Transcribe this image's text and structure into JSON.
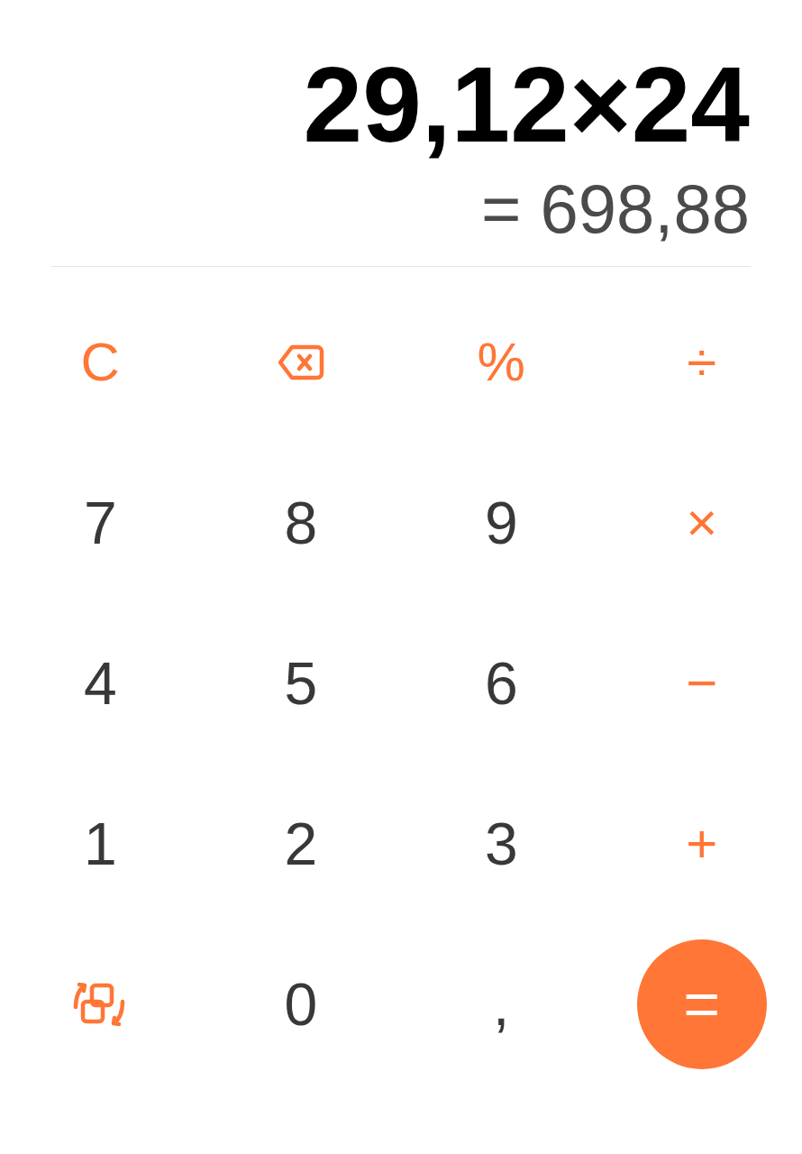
{
  "display": {
    "expression": "29,12×24",
    "result": "= 698,88"
  },
  "keys": [
    {
      "kind": "operator",
      "label": "C"
    },
    {
      "kind": "backspace"
    },
    {
      "kind": "operator",
      "label": "%"
    },
    {
      "kind": "operator",
      "label": "÷"
    },
    {
      "kind": "digit",
      "label": "7"
    },
    {
      "kind": "digit",
      "label": "8"
    },
    {
      "kind": "digit",
      "label": "9"
    },
    {
      "kind": "operator",
      "label": "×"
    },
    {
      "kind": "digit",
      "label": "4"
    },
    {
      "kind": "digit",
      "label": "5"
    },
    {
      "kind": "digit",
      "label": "6"
    },
    {
      "kind": "operator",
      "label": "−"
    },
    {
      "kind": "digit",
      "label": "1"
    },
    {
      "kind": "digit",
      "label": "2"
    },
    {
      "kind": "digit",
      "label": "3"
    },
    {
      "kind": "operator",
      "label": "+"
    },
    {
      "kind": "convert"
    },
    {
      "kind": "digit",
      "label": "0"
    },
    {
      "kind": "digit",
      "label": ","
    },
    {
      "kind": "equals",
      "label": "="
    }
  ]
}
